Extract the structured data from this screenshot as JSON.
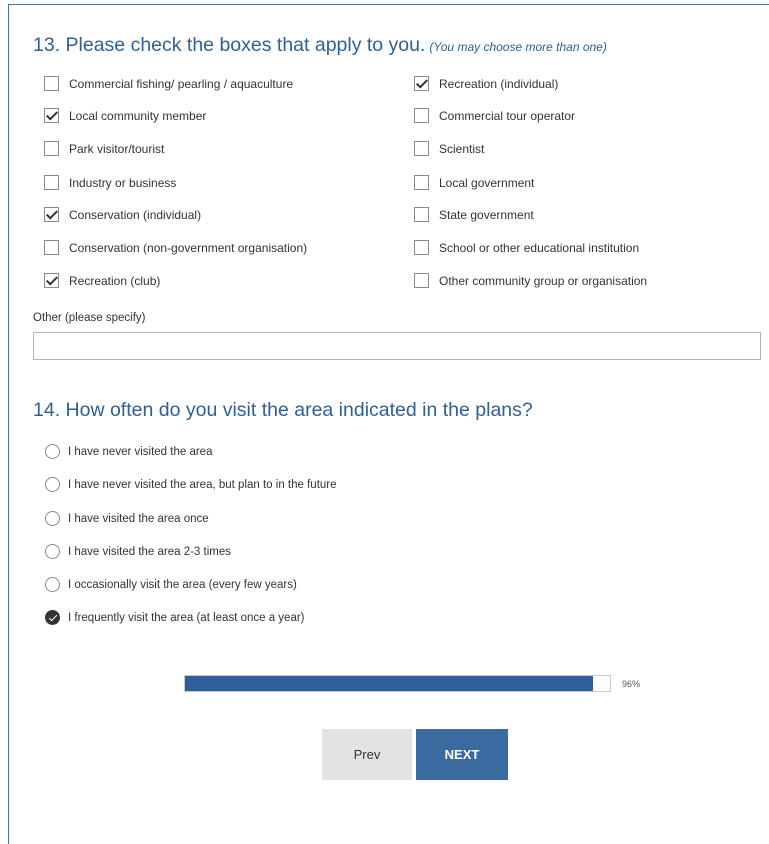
{
  "q13": {
    "title": "13. Please check the boxes that apply to you.",
    "note": "(You may choose more than one)",
    "options_left": [
      {
        "label": "Commercial fishing/ pearling / aquaculture",
        "checked": false
      },
      {
        "label": "Local community member",
        "checked": true
      },
      {
        "label": "Park visitor/tourist",
        "checked": false
      },
      {
        "label": "Industry or business",
        "checked": false
      },
      {
        "label": "Conservation (individual)",
        "checked": true
      },
      {
        "label": "Conservation (non-government organisation)",
        "checked": false
      },
      {
        "label": "Recreation (club)",
        "checked": true
      }
    ],
    "options_right": [
      {
        "label": "Recreation (individual)",
        "checked": true
      },
      {
        "label": "Commercial tour operator",
        "checked": false
      },
      {
        "label": "Scientist",
        "checked": false
      },
      {
        "label": "Local government",
        "checked": false
      },
      {
        "label": "State government",
        "checked": false
      },
      {
        "label": "School or other educational institution",
        "checked": false
      },
      {
        "label": "Other community group or organisation",
        "checked": false
      }
    ],
    "other_label": "Other (please specify)",
    "other_value": ""
  },
  "q14": {
    "title": "14. How often do you visit the area indicated in the plans?",
    "options": [
      {
        "label": "I have never visited the area",
        "checked": false
      },
      {
        "label": "I have never visited the area, but plan to in the future",
        "checked": false
      },
      {
        "label": "I have visited the area once",
        "checked": false
      },
      {
        "label": "I have visited the area 2-3 times",
        "checked": false
      },
      {
        "label": "I occasionally visit the area (every few years)",
        "checked": false
      },
      {
        "label": "I frequently visit the area (at least once a year)",
        "checked": true
      }
    ]
  },
  "progress": {
    "percent": 96,
    "label": "96%"
  },
  "nav": {
    "prev_label": "Prev",
    "next_label": "NEXT"
  }
}
